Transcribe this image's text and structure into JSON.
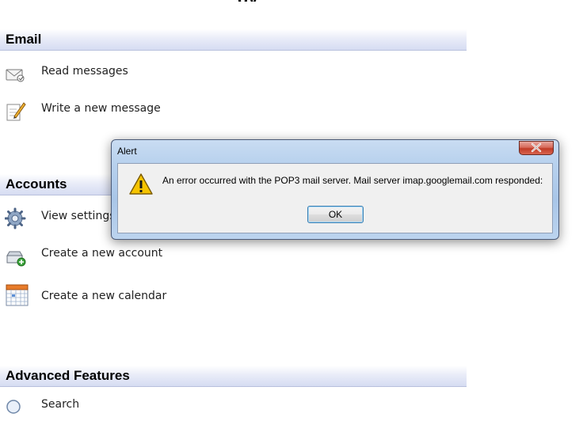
{
  "sections": {
    "email": {
      "title": "Email",
      "items": [
        {
          "label": "Read messages",
          "icon": "envelope-read-icon"
        },
        {
          "label": "Write a new message",
          "icon": "compose-pencil-icon"
        }
      ]
    },
    "accounts": {
      "title": "Accounts",
      "items": [
        {
          "label": "View settings",
          "icon": "gear-settings-icon"
        },
        {
          "label": "Create a new account",
          "icon": "add-account-icon"
        },
        {
          "label": "Create a new calendar",
          "icon": "calendar-icon"
        }
      ]
    },
    "advanced": {
      "title": "Advanced Features",
      "items": [
        {
          "label": "Search",
          "icon": "search-icon"
        }
      ]
    }
  },
  "alert": {
    "title": "Alert",
    "message": "An error occurred with the POP3 mail server. Mail server imap.googlemail.com responded:",
    "ok_label": "OK",
    "icon": "warning-icon"
  },
  "colors": {
    "section_header_bg": "#d6dcf2",
    "dialog_frame": "#b9d2ee",
    "close_button": "#c13b27",
    "warning_yellow": "#f6c400"
  }
}
